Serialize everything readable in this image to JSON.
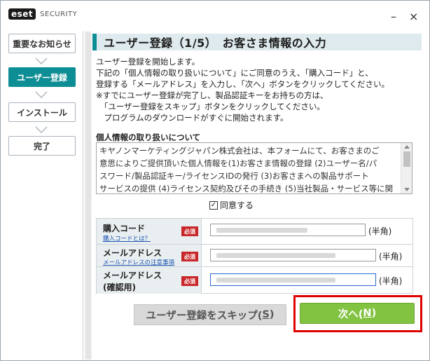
{
  "app": {
    "logo": "eset",
    "logo_sub": "SECURITY",
    "minimize": "–",
    "close": "×"
  },
  "steps": [
    {
      "label": "重要なお知らせ",
      "active": false
    },
    {
      "label": "ユーザー登録",
      "active": true
    },
    {
      "label": "インストール",
      "active": false
    },
    {
      "label": "完了",
      "active": false
    }
  ],
  "heading": "ユーザー登録（1/5）　お客さま情報の入力",
  "intro": [
    "ユーザー登録を開始します。",
    "下記の「個人情報の取り扱いについて」にご同意のうえ、「購入コード」と、",
    "登録する「メールアドレス」を入力し、「次へ」ボタンをクリックしてください。",
    "※すでにユーザー登録が完了し、製品認証キーをお持ちの方は、",
    "　「ユーザー登録をスキップ」ボタンをクリックしてください。",
    "　プログラムのダウンロードがすぐに開始されます。"
  ],
  "privacy": {
    "title": "個人情報の取り扱いについて",
    "lines": [
      "キヤノンマーケティングジャパン株式会社は、本フォームにて、お客さまのご",
      "意思によりご提供頂いた個人情報を(1)お客さま情報の登録 (2)ユーザー名/パ",
      "スワード/製品認証キー/ライセンスIDの発行 (3)お客さまへの製品サポート",
      "サービスの提供 (4)ライセンス契約及びその手続き (5)当社製品・サービス等に関"
    ]
  },
  "agree": {
    "label": "同意する",
    "checked": true,
    "mark": "✓"
  },
  "form": {
    "required_badge": "必須",
    "purchase_code": {
      "label": "購入コード",
      "link": "購入コードとは？",
      "unit": "(半角)"
    },
    "email": {
      "label": "メールアドレス",
      "link": "メールアドレスの注意事項",
      "unit": "(半角)"
    },
    "email_confirm": {
      "label": "メールアドレス",
      "label2": "(確認用)",
      "unit": "(半角)"
    }
  },
  "buttons": {
    "skip": {
      "text": "ユーザー登録をスキップ(",
      "key": "S",
      "end": ")"
    },
    "next": {
      "text": "次へ(",
      "key": "N",
      "end": ")"
    }
  },
  "colors": {
    "accent": "#0d8d94",
    "next_button": "#82c341",
    "required": "#c8282a",
    "highlight": "#e00000"
  }
}
